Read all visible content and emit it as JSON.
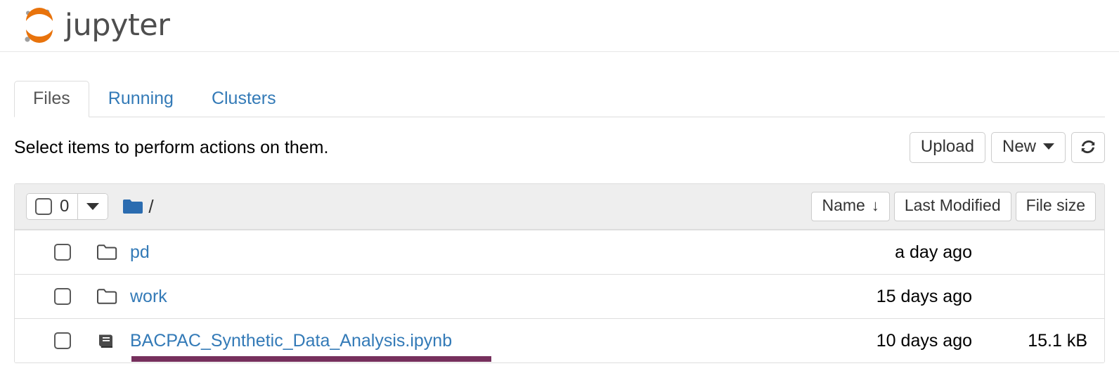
{
  "header": {
    "logo_text": "jupyter",
    "logo_icon": "jupyter-logo",
    "logo_color": "#e8730c"
  },
  "tabs": [
    {
      "label": "Files",
      "active": true
    },
    {
      "label": "Running",
      "active": false
    },
    {
      "label": "Clusters",
      "active": false
    }
  ],
  "actionbar": {
    "hint": "Select items to perform actions on them.",
    "upload_label": "Upload",
    "new_label": "New",
    "refresh_icon": "refresh-icon"
  },
  "filelist": {
    "selected_count": "0",
    "breadcrumb_root": "/",
    "folder_icon": "folder-icon",
    "columns": {
      "name": "Name",
      "name_sort_arrow": "↓",
      "last_modified": "Last Modified",
      "file_size": "File size"
    },
    "rows": [
      {
        "type": "folder",
        "icon": "folder-outline-icon",
        "name": "pd",
        "last_modified": "a day ago",
        "size": "",
        "highlighted": false
      },
      {
        "type": "folder",
        "icon": "folder-outline-icon",
        "name": "work",
        "last_modified": "15 days ago",
        "size": "",
        "highlighted": false
      },
      {
        "type": "notebook",
        "icon": "notebook-icon",
        "name": "BACPAC_Synthetic_Data_Analysis.ipynb",
        "last_modified": "10 days ago",
        "size": "15.1 kB",
        "highlighted": true,
        "highlight_color": "#76305d"
      }
    ]
  }
}
